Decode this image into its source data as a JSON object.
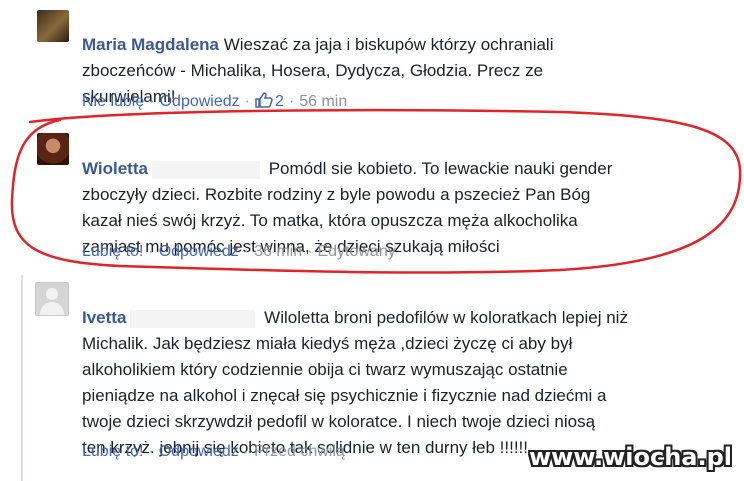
{
  "comments": [
    {
      "author": "Maria Magdalena",
      "lines": [
        "Wieszać za jaja i biskupów którzy ochraniali",
        "zboczeńców - Michalika, Hosera, Dydycza, Głodzia. Precz ze",
        "skurwielami!"
      ],
      "actions": {
        "like": "Nie lubię",
        "reply": "Odpowiedz",
        "like_count": "2",
        "time": "56 min"
      }
    },
    {
      "author": "Wioletta",
      "lines": [
        "Pomódl sie kobieto. To lewackie nauki gender",
        "zboczyły dzieci. Rozbite rodziny z byle powodu a pszecież Pan Bóg",
        "kazał nieś swój krzyż. To matka, która opuszcza męża alkocholika",
        "zamiast mu pomóc jest winna, że dzieci szukają miłości"
      ],
      "actions": {
        "like": "Lubię to!",
        "reply": "Odpowiedz",
        "time": "36 min",
        "edited": "Edytowany"
      }
    },
    {
      "author": "Ivetta",
      "lines": [
        "Wiloletta broni pedofilów w koloratkach lepiej niż",
        "Michalik. Jak będziesz miała kiedyś męża ,dzieci życzę ci aby był",
        "alkoholikiem który codziennie obija ci twarz wymuszając ostatnie",
        "pieniądze na alkohol i znęcał się psychicznie i fizycznie nad dziećmi a",
        "twoje dzieci skrzywdził pedofil w koloratce. I niech twoje dzieci niosą",
        "ten krzyż. jebnij się kobieto tak solidnie w ten durny łeb !!!!!!"
      ],
      "actions": {
        "like": "Lubię to!",
        "reply": "Odpowiedz",
        "time": "Przed chwilą"
      }
    }
  ],
  "watermark": "www.wiocha.pl",
  "colors": {
    "link": "#4267b2",
    "author": "#3b5998",
    "meta": "#90949c",
    "highlight": "#e0242a"
  },
  "icons": {
    "like": "thumbs-up-icon",
    "default_avatar": "default-avatar-icon"
  }
}
